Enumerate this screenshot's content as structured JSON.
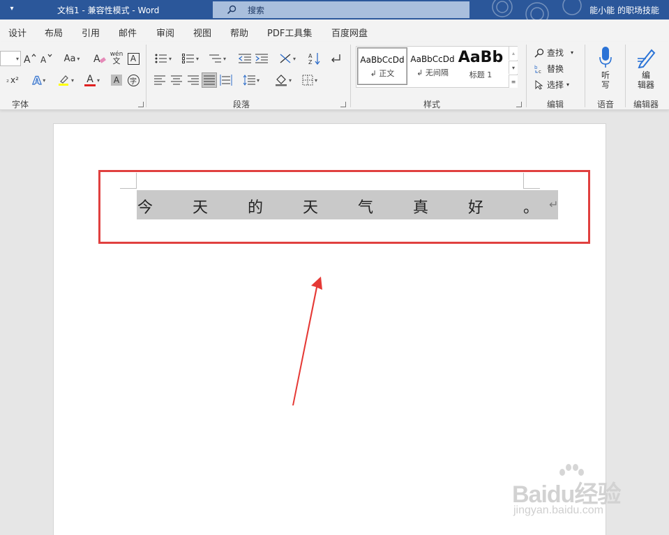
{
  "titlebar": {
    "title": "文档1  -  兼容性模式  -  Word",
    "search_placeholder": "搜索",
    "account": "能小能 的职场技能"
  },
  "tabs": [
    "设计",
    "布局",
    "引用",
    "邮件",
    "审阅",
    "视图",
    "帮助",
    "PDF工具集",
    "百度网盘"
  ],
  "ribbon": {
    "groups": {
      "font": "字体",
      "paragraph": "段落",
      "styles": "样式",
      "editing": "编辑",
      "voice": "语音",
      "editor": "编辑器"
    },
    "font_buttons": {
      "case": "Aa",
      "phonetic_top": "wén",
      "phonetic_bottom": "文",
      "char_border": "A",
      "superscript": "x²",
      "text_effects": "A",
      "font_color": "A",
      "char_shading": "A",
      "enclose": "字"
    },
    "styles": [
      {
        "preview": "AaBbCcDd",
        "name": "↲ 正文",
        "selected": true
      },
      {
        "preview": "AaBbCcDd",
        "name": "↲ 无间隔",
        "selected": false
      },
      {
        "preview": "AaBb",
        "name": "标题 1",
        "selected": false
      }
    ],
    "editing": {
      "find": "查找",
      "replace": "替换",
      "select": "选择"
    },
    "dictate": [
      "听",
      "写"
    ],
    "editor": [
      "编",
      "辑器"
    ]
  },
  "document": {
    "characters": [
      "今",
      "天",
      "的",
      "天",
      "气",
      "真",
      "好",
      "。"
    ],
    "paragraph_mark": "↵"
  },
  "watermark": {
    "brand": "Baidu经验",
    "url": "jingyan.baidu.com"
  },
  "colors": {
    "titlebar": "#2b579a",
    "highlight_border": "#e0403f",
    "selection": "#c9c9c9",
    "font_color_red": "#e02020",
    "highlight_yellow": "#ffff00"
  }
}
